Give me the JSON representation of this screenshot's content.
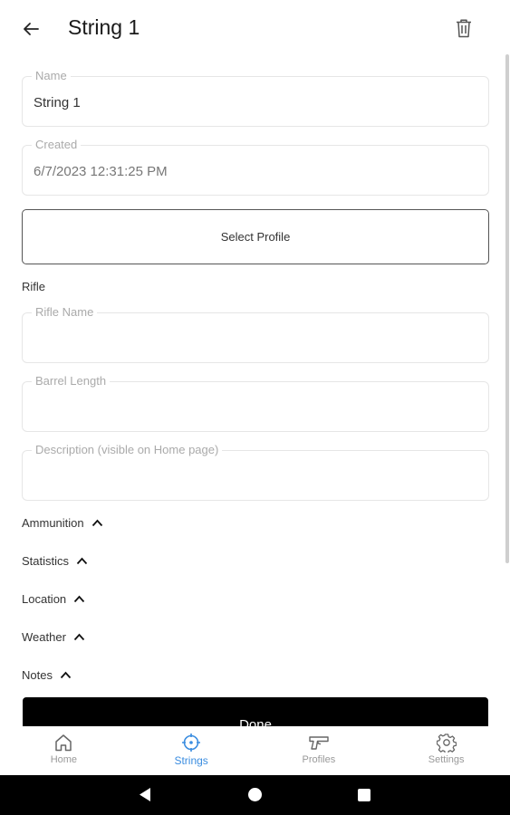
{
  "appbar": {
    "title": "String 1"
  },
  "form": {
    "name": {
      "label": "Name",
      "value": "String 1"
    },
    "created": {
      "label": "Created",
      "value": "6/7/2023 12:31:25 PM"
    },
    "select_profile_label": "Select Profile",
    "rifle_section_label": "Rifle",
    "rifle_name": {
      "label": "Rifle Name",
      "value": ""
    },
    "barrel_length": {
      "label": "Barrel Length",
      "value": ""
    },
    "description": {
      "label": "Description (visible on Home page)",
      "value": ""
    }
  },
  "sections": [
    {
      "label": "Ammunition"
    },
    {
      "label": "Statistics"
    },
    {
      "label": "Location"
    },
    {
      "label": "Weather"
    },
    {
      "label": "Notes"
    }
  ],
  "done_label": "Done",
  "bottom_nav": {
    "items": [
      {
        "label": "Home",
        "icon": "home-icon"
      },
      {
        "label": "Strings",
        "icon": "crosshair-icon",
        "active": true
      },
      {
        "label": "Profiles",
        "icon": "pistol-icon"
      },
      {
        "label": "Settings",
        "icon": "gear-icon"
      }
    ],
    "active_color": "#3b8de0",
    "inactive_color": "#999999"
  }
}
